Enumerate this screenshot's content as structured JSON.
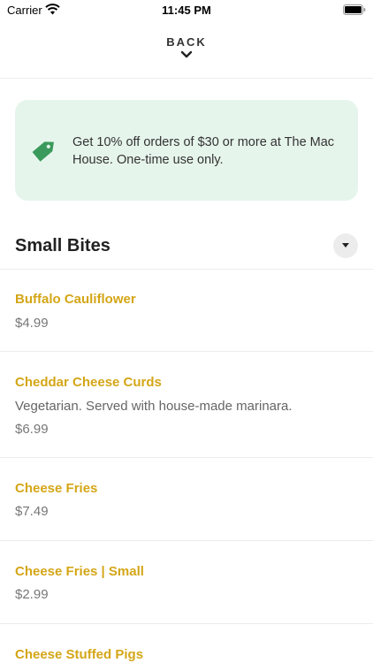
{
  "status_bar": {
    "carrier": "Carrier",
    "time": "11:45 PM"
  },
  "nav": {
    "back_label": "BACK"
  },
  "promo": {
    "text": "Get 10% off orders of $30 or more at The Mac House. One-time use only.",
    "icon": "tag-icon",
    "accent_color": "#3a9a5c",
    "background_color": "#e6f5ec"
  },
  "section": {
    "title": "Small Bites"
  },
  "colors": {
    "item_name": "#d4a617"
  },
  "menu_items": [
    {
      "name": "Buffalo Cauliflower",
      "description": "",
      "price": "$4.99"
    },
    {
      "name": "Cheddar Cheese Curds",
      "description": "Vegetarian. Served with house-made marinara.",
      "price": "$6.99"
    },
    {
      "name": "Cheese Fries",
      "description": "",
      "price": "$7.49"
    },
    {
      "name": "Cheese Fries | Small",
      "description": "",
      "price": "$2.99"
    },
    {
      "name": "Cheese Stuffed Pigs",
      "description": "",
      "price": ""
    }
  ]
}
